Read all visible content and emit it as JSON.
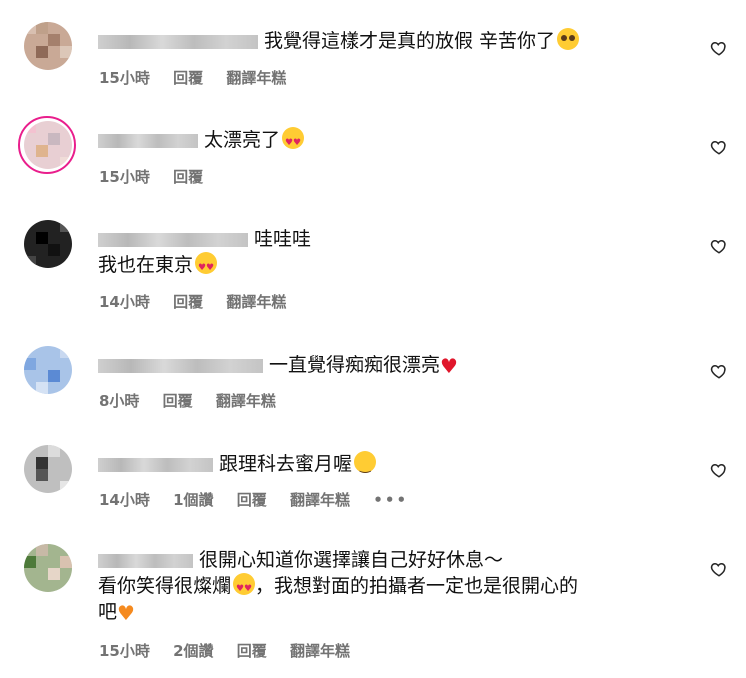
{
  "comments": [
    {
      "text": "我覺得這樣才是真的放假 辛苦你了",
      "emoji": "pleading-face",
      "meta": {
        "time": "15小時",
        "reply": "回覆",
        "translate": "翻譯年糕"
      }
    },
    {
      "text": "太漂亮了",
      "emoji": "heart-eyes",
      "meta": {
        "time": "15小時",
        "reply": "回覆"
      }
    },
    {
      "text": "哇哇哇",
      "line2": "我也在東京",
      "emoji": "heart-eyes",
      "meta": {
        "time": "14小時",
        "reply": "回覆",
        "translate": "翻譯年糕"
      }
    },
    {
      "text": "一直覺得痴痴很漂亮",
      "emoji": "red-heart",
      "meta": {
        "time": "8小時",
        "reply": "回覆",
        "translate": "翻譯年糕"
      }
    },
    {
      "text": "跟理科去蜜月喔",
      "emoji": "smirking-face",
      "meta": {
        "time": "14小時",
        "likes": "1個讚",
        "reply": "回覆",
        "translate": "翻譯年糕",
        "more": "•••"
      }
    },
    {
      "text": "很開心知道你選擇讓自己好好休息～",
      "line2a": "看你笑得很燦爛",
      "line2b": "，我想對面的拍攝者一定也是很開心的",
      "line3": "吧",
      "emoji": "heart-eyes",
      "emoji2": "orange-heart",
      "meta": {
        "time": "15小時",
        "likes": "2個讚",
        "reply": "回覆",
        "translate": "翻譯年糕"
      }
    }
  ],
  "colors": {
    "meta": "#737373",
    "story_ring": "#e91e8c",
    "red_heart": "#e0162b",
    "orange_heart": "#f58a1f"
  },
  "icons": {
    "like": "heart-outline-icon"
  }
}
